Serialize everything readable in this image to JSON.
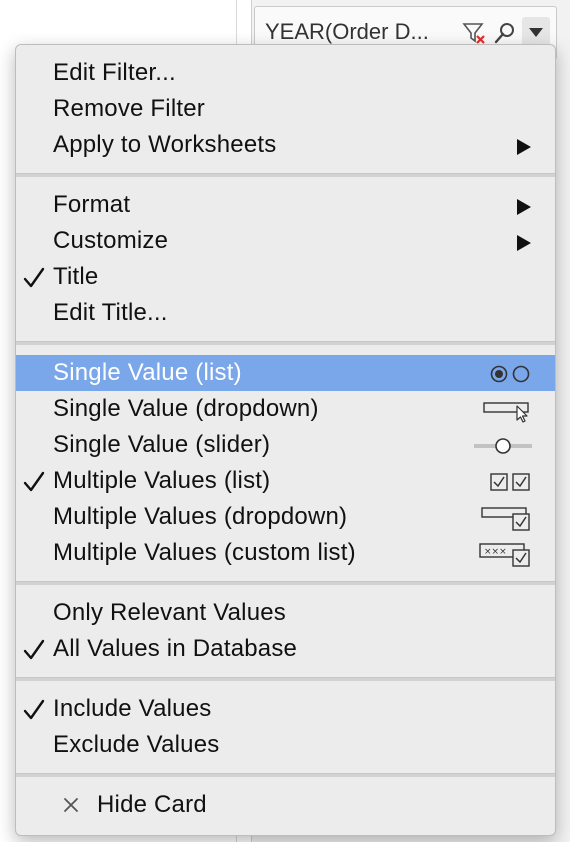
{
  "card": {
    "title": "YEAR(Order D...",
    "icons": [
      "remove-filter-icon",
      "search-icon",
      "dropdown-arrow-icon"
    ]
  },
  "menu": {
    "group_filter": [
      {
        "label": "Edit Filter...",
        "checked": false
      },
      {
        "label": "Remove Filter",
        "checked": false
      },
      {
        "label": "Apply to Worksheets",
        "checked": false,
        "submenu": true
      }
    ],
    "group_format": [
      {
        "label": "Format",
        "checked": false,
        "submenu": true
      },
      {
        "label": "Customize",
        "checked": false,
        "submenu": true
      },
      {
        "label": "Title",
        "checked": true
      },
      {
        "label": "Edit Title...",
        "checked": false
      }
    ],
    "group_mode": [
      {
        "label": "Single Value (list)",
        "checked": false,
        "highlighted": true,
        "icon": "radio-list-icon"
      },
      {
        "label": "Single Value (dropdown)",
        "checked": false,
        "icon": "dropdown-select-icon"
      },
      {
        "label": "Single Value (slider)",
        "checked": false,
        "icon": "slider-icon"
      },
      {
        "label": "Multiple Values (list)",
        "checked": true,
        "icon": "checkbox-list-icon"
      },
      {
        "label": "Multiple Values (dropdown)",
        "checked": false,
        "icon": "checkbox-dropdown-icon"
      },
      {
        "label": "Multiple Values (custom list)",
        "checked": false,
        "icon": "custom-list-icon"
      }
    ],
    "group_values": [
      {
        "label": "Only Relevant Values",
        "checked": false
      },
      {
        "label": "All Values in Database",
        "checked": true
      }
    ],
    "group_include": [
      {
        "label": "Include Values",
        "checked": true
      },
      {
        "label": "Exclude Values",
        "checked": false
      }
    ],
    "hide_card": {
      "label": "Hide Card",
      "icon": "close-icon"
    }
  },
  "colors": {
    "highlight": "#7aa6ea",
    "menu_bg": "#ececec",
    "separator": "#d2d2d2"
  }
}
